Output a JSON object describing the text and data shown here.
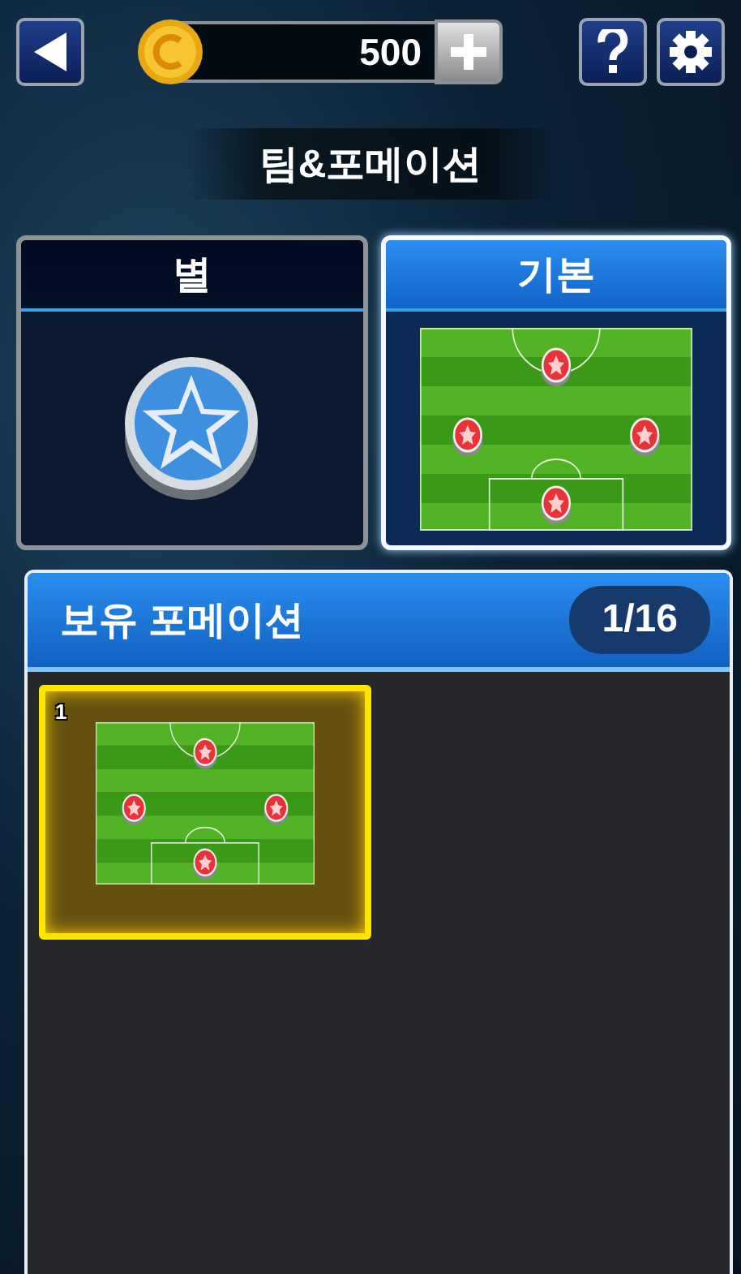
{
  "top_bar": {
    "coins": "500"
  },
  "title": "팀&포메이션",
  "team_cards": [
    {
      "label": "별",
      "kind": "emblem",
      "selected": false
    },
    {
      "label": "기본",
      "kind": "formation",
      "selected": true
    }
  ],
  "owned": {
    "title": "보유 포메이션",
    "count": "1/16",
    "slots": [
      {
        "number": "1",
        "selected": true
      }
    ]
  }
}
